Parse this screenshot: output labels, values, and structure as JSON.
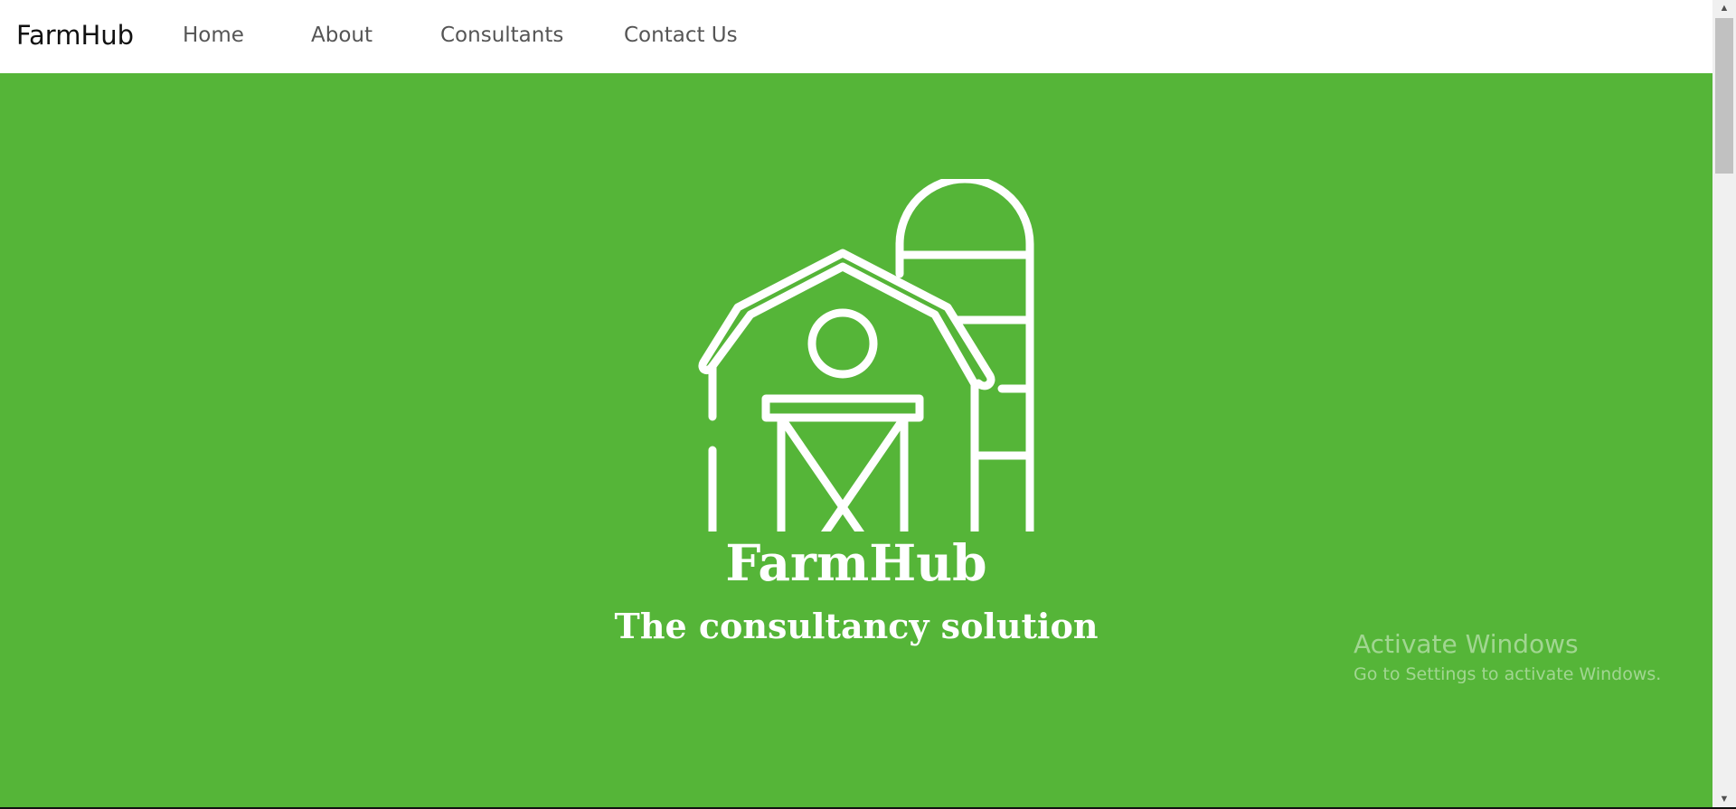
{
  "navbar": {
    "brand": "FarmHub",
    "links": [
      {
        "label": "Home"
      },
      {
        "label": "About"
      },
      {
        "label": "Consultants"
      },
      {
        "label": "Contact Us"
      }
    ]
  },
  "hero": {
    "background_color": "#55b538",
    "icon": "barn-silo-icon",
    "title": "FarmHub",
    "subtitle": "The consultancy solution"
  },
  "watermark": {
    "title": "Activate Windows",
    "subtitle": "Go to Settings to activate Windows."
  }
}
